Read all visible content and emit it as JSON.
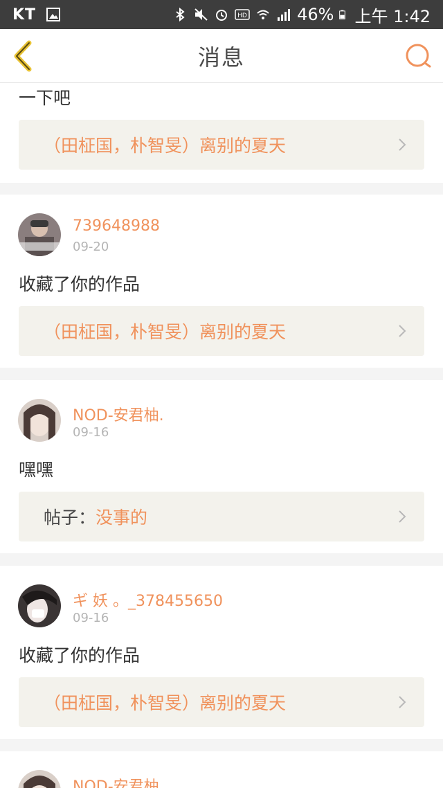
{
  "status_bar": {
    "carrier": "KT",
    "battery": "46%",
    "time": "上午 1:42"
  },
  "header": {
    "title": "消息"
  },
  "colors": {
    "accent": "#f0925c",
    "back_icon": "#e8c234",
    "ref_bg": "#f3f2ec"
  },
  "messages": [
    {
      "text": "一下吧",
      "ref_title": "（田柾国，朴智旻）离别的夏天"
    },
    {
      "username": "739648988",
      "date": "09-20",
      "text": "收藏了你的作品",
      "ref_title": "（田柾国，朴智旻）离别的夏天"
    },
    {
      "username": "NOD-安君柚.",
      "date": "09-16",
      "text": "嘿嘿",
      "ref_prefix": "帖子：",
      "ref_title": "没事的"
    },
    {
      "username": "ギ 妖 。_378455650",
      "date": "09-16",
      "text": "收藏了你的作品",
      "ref_title": "（田柾国，朴智旻）离别的夏天"
    },
    {
      "username": "NOD-安君柚."
    }
  ]
}
